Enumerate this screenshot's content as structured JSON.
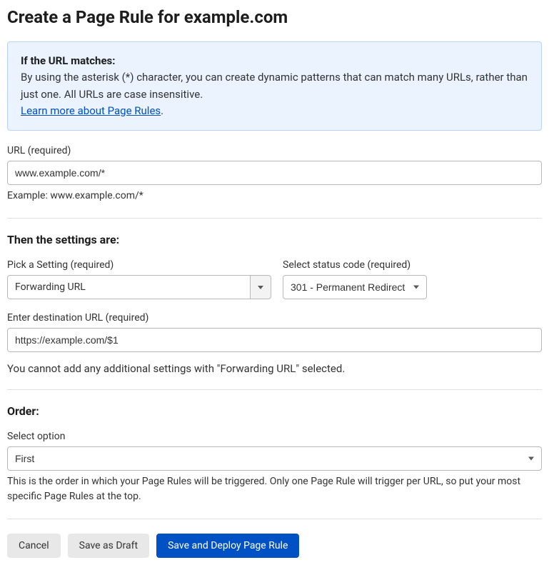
{
  "title": "Create a Page Rule for example.com",
  "infoBox": {
    "heading": "If the URL matches:",
    "body": "By using the asterisk (*) character, you can create dynamic patterns that can match many URLs, rather than just one. All URLs are case insensitive.",
    "linkText": "Learn more about Page Rules",
    "period": "."
  },
  "url": {
    "label": "URL (required)",
    "value": "www.example.com/*",
    "example": "Example: www.example.com/*"
  },
  "settingsHeading": "Then the settings are:",
  "setting": {
    "label": "Pick a Setting (required)",
    "value": "Forwarding URL"
  },
  "statusCode": {
    "label": "Select status code (required)",
    "value": "301 - Permanent Redirect"
  },
  "destination": {
    "label": "Enter destination URL (required)",
    "value": "https://example.com/$1"
  },
  "forwardingNote": "You cannot add any additional settings with \"Forwarding URL\" selected.",
  "orderHeading": "Order:",
  "order": {
    "label": "Select option",
    "value": "First",
    "help": "This is the order in which your Page Rules will be triggered. Only one Page Rule will trigger per URL, so put your most specific Page Rules at the top."
  },
  "buttons": {
    "cancel": "Cancel",
    "saveDraft": "Save as Draft",
    "saveDeploy": "Save and Deploy Page Rule"
  }
}
